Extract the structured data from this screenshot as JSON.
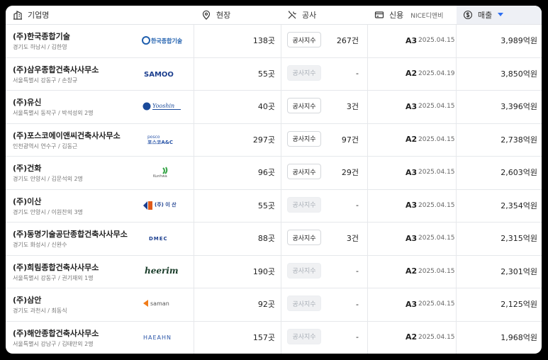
{
  "header": {
    "company": "기업명",
    "site": "현장",
    "construction": "공사",
    "credit": "신용",
    "credit_sub": "NICE디앤비",
    "revenue": "매출"
  },
  "colors": {
    "sort_arrow": "#2d6ff2",
    "sorted_col_bg": "#eef0f5"
  },
  "rows": [
    {
      "name": "(주)한국종합기술",
      "addr": "경기도 하남시 / 김한영",
      "logo": "한국종합기술",
      "sites": "138곳",
      "btn": "공사지수",
      "btn_disabled": false,
      "count": "267건",
      "grade": "A3",
      "date": "2025.04.15",
      "revenue": "3,989억원"
    },
    {
      "name": "(주)삼우종합건축사사무소",
      "addr": "서울특별시 강동구 / 손창규",
      "logo": "SAMOO",
      "sites": "55곳",
      "btn": "공사지수",
      "btn_disabled": true,
      "count": "-",
      "grade": "A2",
      "date": "2025.04.19",
      "revenue": "3,850억원"
    },
    {
      "name": "(주)유신",
      "addr": "서울특별시 동작구 / 박석성외 2명",
      "logo": "Yooshin",
      "sites": "40곳",
      "btn": "공사지수",
      "btn_disabled": false,
      "count": "3건",
      "grade": "A3",
      "date": "2025.04.15",
      "revenue": "3,396억원"
    },
    {
      "name": "(주)포스코에이앤씨건축사사무소",
      "addr": "인천광역시 연수구 / 김동근",
      "logo": "posco 포스코A&C",
      "sites": "297곳",
      "btn": "공사지수",
      "btn_disabled": false,
      "count": "97건",
      "grade": "A2",
      "date": "2025.04.15",
      "revenue": "2,738억원"
    },
    {
      "name": "(주)건화",
      "addr": "경기도 안양시 / 김문석외 2명",
      "logo": "Kunhwa",
      "sites": "96곳",
      "btn": "공사지수",
      "btn_disabled": false,
      "count": "29건",
      "grade": "A3",
      "date": "2025.04.15",
      "revenue": "2,603억원"
    },
    {
      "name": "(주)이산",
      "addr": "경기도 안양시 / 이원찬외 3명",
      "logo": "(주) 이 산",
      "sites": "55곳",
      "btn": "공사지수",
      "btn_disabled": true,
      "count": "-",
      "grade": "A3",
      "date": "2025.04.15",
      "revenue": "2,354억원"
    },
    {
      "name": "(주)동명기술공단종합건축사사무소",
      "addr": "경기도 화성시 / 신완수",
      "logo": "DMEC",
      "sites": "88곳",
      "btn": "공사지수",
      "btn_disabled": false,
      "count": "3건",
      "grade": "A3",
      "date": "2025.04.15",
      "revenue": "2,315억원"
    },
    {
      "name": "(주)희림종합건축사사무소",
      "addr": "서울특별시 강동구 / 권기재외 1명",
      "logo": "heerim",
      "sites": "190곳",
      "btn": "공사지수",
      "btn_disabled": true,
      "count": "-",
      "grade": "A2",
      "date": "2025.04.15",
      "revenue": "2,301억원"
    },
    {
      "name": "(주)삼안",
      "addr": "경기도 과천시 / 최동식",
      "logo": "saman",
      "sites": "92곳",
      "btn": "공사지수",
      "btn_disabled": true,
      "count": "-",
      "grade": "A3",
      "date": "2025.04.15",
      "revenue": "2,125억원"
    },
    {
      "name": "(주)해안종합건축사사무소",
      "addr": "서울특별시 강남구 / 김태만외 2명",
      "logo": "HAEAHN",
      "sites": "157곳",
      "btn": "공사지수",
      "btn_disabled": true,
      "count": "-",
      "grade": "A2",
      "date": "2025.04.15",
      "revenue": "1,968억원"
    }
  ]
}
